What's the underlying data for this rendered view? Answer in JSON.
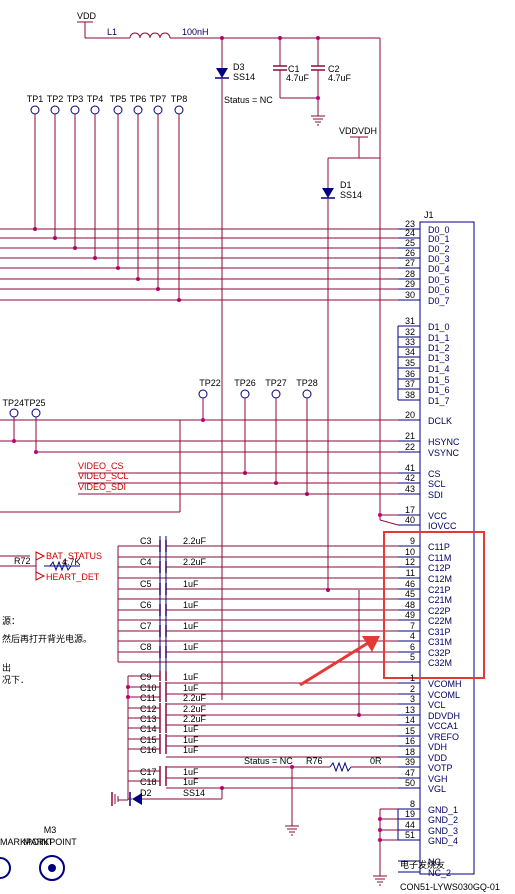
{
  "power": {
    "vdd": "VDD",
    "vddvdh": "VDDVDH"
  },
  "inductor": {
    "ref": "L1",
    "value": "100nH"
  },
  "diodes": [
    {
      "ref": "D3",
      "part": "SS14",
      "status": "Status = NC"
    },
    {
      "ref": "D1",
      "part": "SS14"
    },
    {
      "ref": "D2",
      "part": "SS14"
    }
  ],
  "top_caps": [
    {
      "ref": "C1",
      "value": "4.7uF"
    },
    {
      "ref": "C2",
      "value": "4.7uF"
    }
  ],
  "testpoints_top": [
    "TP1",
    "TP2",
    "TP3",
    "TP4",
    "TP5",
    "TP6",
    "TP7",
    "TP8"
  ],
  "testpoints_mid": [
    "TP22",
    "TP26",
    "TP27",
    "TP28"
  ],
  "testpoints_left": "TP24TP25",
  "connector": {
    "ref": "J1",
    "part": "CON51-LYWS030GQ-01"
  },
  "pins_d0": [
    {
      "num": "23",
      "name": "D0_0"
    },
    {
      "num": "24",
      "name": "D0_1"
    },
    {
      "num": "25",
      "name": "D0_2"
    },
    {
      "num": "26",
      "name": "D0_3"
    },
    {
      "num": "27",
      "name": "D0_4"
    },
    {
      "num": "28",
      "name": "D0_5"
    },
    {
      "num": "29",
      "name": "D0_6"
    },
    {
      "num": "30",
      "name": "D0_7"
    }
  ],
  "pins_d1": [
    {
      "num": "31",
      "name": "D1_0"
    },
    {
      "num": "32",
      "name": "D1_1"
    },
    {
      "num": "33",
      "name": "D1_2"
    },
    {
      "num": "34",
      "name": "D1_3"
    },
    {
      "num": "35",
      "name": "D1_4"
    },
    {
      "num": "36",
      "name": "D1_5"
    },
    {
      "num": "37",
      "name": "D1_6"
    },
    {
      "num": "38",
      "name": "D1_7"
    }
  ],
  "pins_ctrl": [
    {
      "num": "20",
      "name": "DCLK"
    },
    {
      "num": "21",
      "name": "HSYNC"
    },
    {
      "num": "22",
      "name": "VSYNC"
    },
    {
      "num": "41",
      "name": "CS"
    },
    {
      "num": "42",
      "name": "SCL"
    },
    {
      "num": "43",
      "name": "SDI"
    },
    {
      "num": "17",
      "name": "VCC"
    },
    {
      "num": "40",
      "name": "IOVCC"
    }
  ],
  "pins_pump": [
    {
      "num": "9",
      "name": "C11P"
    },
    {
      "num": "10",
      "name": "C11M"
    },
    {
      "num": "12",
      "name": "C12P"
    },
    {
      "num": "11",
      "name": "C12M"
    },
    {
      "num": "46",
      "name": "C21P"
    },
    {
      "num": "45",
      "name": "C21M"
    },
    {
      "num": "48",
      "name": "C22P"
    },
    {
      "num": "49",
      "name": "C22M"
    },
    {
      "num": "7",
      "name": "C31P"
    },
    {
      "num": "4",
      "name": "C31M"
    },
    {
      "num": "6",
      "name": "C32P"
    },
    {
      "num": "5",
      "name": "C32M"
    }
  ],
  "pins_power": [
    {
      "num": "1",
      "name": "VCOMH"
    },
    {
      "num": "2",
      "name": "VCOML"
    },
    {
      "num": "3",
      "name": "VCL"
    },
    {
      "num": "13",
      "name": "DDVDH"
    },
    {
      "num": "14",
      "name": "VCCA1"
    },
    {
      "num": "15",
      "name": "VREFO"
    },
    {
      "num": "16",
      "name": "VDH"
    },
    {
      "num": "18",
      "name": "VDD"
    },
    {
      "num": "39",
      "name": "VOTP"
    },
    {
      "num": "47",
      "name": "VGH"
    },
    {
      "num": "50",
      "name": "VGL"
    }
  ],
  "pins_gnd": [
    {
      "num": "8",
      "name": "GND_1"
    },
    {
      "num": "19",
      "name": "GND_2"
    },
    {
      "num": "44",
      "name": "GND_3"
    },
    {
      "num": "51",
      "name": "GND_4"
    },
    {
      "num": "",
      "name": "NC"
    },
    {
      "num": "",
      "name": "NC_2"
    }
  ],
  "video_nets": [
    "VIDEO_CS",
    "VIDEO_SCL",
    "VIDEO_SDI"
  ],
  "pump_caps": [
    {
      "ref": "C3",
      "value": "2.2uF"
    },
    {
      "ref": "C4",
      "value": "2.2uF"
    },
    {
      "ref": "C5",
      "value": "1uF"
    },
    {
      "ref": "C6",
      "value": "1uF"
    },
    {
      "ref": "C7",
      "value": "1uF"
    },
    {
      "ref": "C8",
      "value": "1uF"
    }
  ],
  "power_caps": [
    {
      "ref": "C9",
      "value": "1uF"
    },
    {
      "ref": "C10",
      "value": "1uF"
    },
    {
      "ref": "C11",
      "value": "2.2uF"
    },
    {
      "ref": "C12",
      "value": "2.2uF"
    },
    {
      "ref": "C13",
      "value": "2.2uF"
    },
    {
      "ref": "C14",
      "value": "1uF"
    },
    {
      "ref": "C15",
      "value": "1uF"
    },
    {
      "ref": "C16",
      "value": "1uF"
    },
    {
      "ref": "C17",
      "value": "1uF"
    },
    {
      "ref": "C18",
      "value": "1uF"
    }
  ],
  "r72": {
    "ref": "R72",
    "value": "4.7K"
  },
  "r76": {
    "ref": "R76",
    "value": "0R",
    "status": "Status = NC"
  },
  "net_labels": {
    "bat": "BAT_STATUS",
    "heart": "HEART_DET"
  },
  "notes": [
    "源：",
    "然后再打开背光电源。",
    "出",
    "况下．"
  ],
  "markpoints": {
    "left": "MARKPOINT",
    "m3": "M3",
    "m3_label": "MARKPOINT"
  },
  "watermark": "电子发烧友",
  "colors": {
    "wire": "#8b0a3a",
    "text": "#000066",
    "red": "#cc0000",
    "box": "#e53935",
    "node": "#c0007a"
  }
}
